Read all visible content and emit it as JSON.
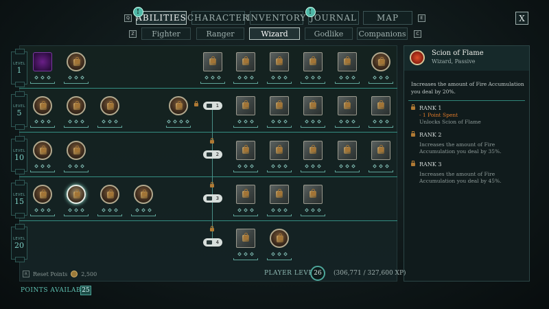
{
  "nav": {
    "tabs": [
      {
        "label": "ABILITIES",
        "active": true,
        "alert": "!"
      },
      {
        "label": "CHARACTER",
        "active": false
      },
      {
        "label": "INVENTORY",
        "active": false
      },
      {
        "label": "JOURNAL",
        "active": false,
        "alert": "!"
      },
      {
        "label": "MAP",
        "active": false
      }
    ],
    "key_left": "Q",
    "key_right": "E",
    "close_label": "X"
  },
  "subnav": {
    "tabs": [
      {
        "label": "Fighter",
        "active": false
      },
      {
        "label": "Ranger",
        "active": false
      },
      {
        "label": "Wizard",
        "active": true
      },
      {
        "label": "Godlike",
        "active": false
      },
      {
        "label": "Companions",
        "active": false
      }
    ],
    "key_left": "Z",
    "key_right": "C"
  },
  "levels": [
    {
      "word": "LEVEL",
      "number": "1"
    },
    {
      "word": "LEVEL",
      "number": "5"
    },
    {
      "word": "LEVEL",
      "number": "10"
    },
    {
      "word": "LEVEL",
      "number": "15"
    },
    {
      "word": "LEVEL",
      "number": "20"
    }
  ],
  "gates": [
    "1",
    "2",
    "3",
    "4"
  ],
  "selected_ability": {
    "name": "Scion of Flame",
    "subtitle": "Wizard, Passive",
    "description": "Increases the amount of Fire Accumulation you deal by 20%.",
    "ranks": [
      {
        "title": "RANK 1",
        "spent": "- 1 Point Spent",
        "detail": "Unlocks Scion of Flame"
      },
      {
        "title": "RANK 2",
        "detail": "Increases the amount of Fire Accumulation you deal by 35%."
      },
      {
        "title": "RANK 3",
        "detail": "Increases the amount of Fire Accumulation you deal by 45%."
      }
    ]
  },
  "footer": {
    "reset_key": "R",
    "reset_label": "Reset Points",
    "reset_cost": "2,500",
    "player_level_label": "PLAYER LEVEL",
    "player_level": "26",
    "xp": "(306,771 / 327,600 XP)",
    "points_label": "POINTS AVAILABLE",
    "points": "25"
  },
  "colors": {
    "accent": "#3aa294",
    "highlight_text": "#e07a2a",
    "lock": "#b07a34"
  }
}
